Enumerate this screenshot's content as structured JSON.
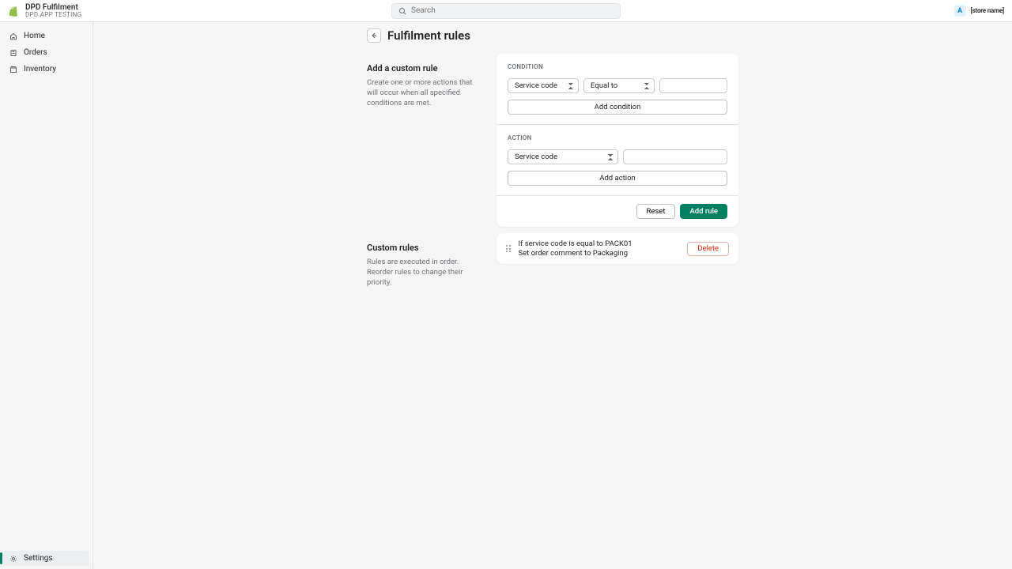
{
  "topbar": {
    "title": "DPD Fulfilment",
    "subtitle": "DPD APP TESTING",
    "search_placeholder": "Search",
    "avatar_initial": "A",
    "store_name": "[store name]"
  },
  "sidebar": {
    "items": [
      {
        "label": "Home",
        "name": "sidebar-item-home"
      },
      {
        "label": "Orders",
        "name": "sidebar-item-orders"
      },
      {
        "label": "Inventory",
        "name": "sidebar-item-inventory"
      }
    ],
    "settings_label": "Settings"
  },
  "page": {
    "title": "Fulfilment rules"
  },
  "add_section": {
    "heading": "Add a custom rule",
    "desc": "Create one or more actions that will occur when all specified conditions are met.",
    "condition_label": "CONDITION",
    "condition_field_select": "Service code",
    "condition_operator_select": "Equal to",
    "condition_value": "",
    "add_condition_label": "Add condition",
    "action_label": "ACTION",
    "action_field_select": "Service code",
    "action_value": "",
    "add_action_label": "Add action",
    "reset_label": "Reset",
    "add_rule_label": "Add rule"
  },
  "custom_section": {
    "heading": "Custom rules",
    "desc": "Rules are executed in order. Reorder rules to change their priority.",
    "rules": [
      {
        "line1": "If service code is equal to PACK01",
        "line2": "Set order comment to Packaging"
      }
    ],
    "delete_label": "Delete"
  }
}
